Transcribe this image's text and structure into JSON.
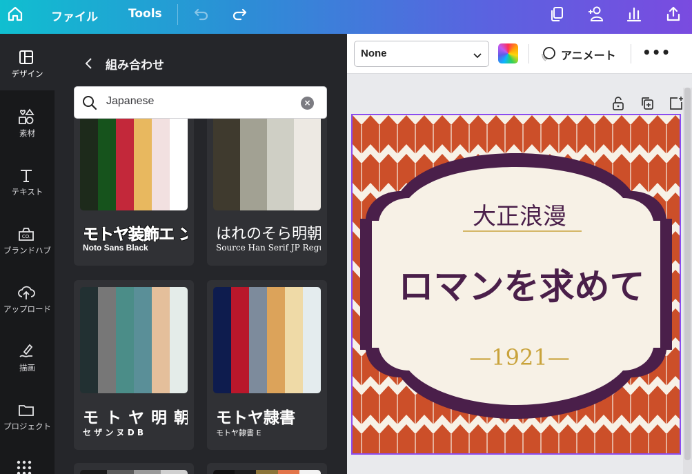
{
  "topbar": {
    "file_label": "ファイル",
    "tools_label": "Tools",
    "icons": [
      "home-icon",
      "undo-icon",
      "redo-icon",
      "copy-icon",
      "add-people-icon",
      "chart-icon",
      "share-icon"
    ]
  },
  "rail": {
    "items": [
      {
        "label": "デザイン",
        "icon": "layout-icon"
      },
      {
        "label": "素材",
        "icon": "shapes-icon"
      },
      {
        "label": "テキスト",
        "icon": "text-icon"
      },
      {
        "label": "ブランドハブ",
        "icon": "brand-icon"
      },
      {
        "label": "アップロード",
        "icon": "upload-icon"
      },
      {
        "label": "描画",
        "icon": "draw-icon"
      },
      {
        "label": "プロジェクト",
        "icon": "folder-icon"
      }
    ]
  },
  "panel": {
    "title": "組み合わせ",
    "search": {
      "value": "Japanese"
    },
    "cards": [
      {
        "title": "モトヤ装飾エ ン",
        "subtitle": "Noto Sans Black",
        "colors": [
          "#1d2a1b",
          "#16531c",
          "#c3283a",
          "#e8b85f",
          "#f2e0e0",
          "#ffffff"
        ]
      },
      {
        "title": "はれのそら明朝",
        "subtitle": "Source Han Serif JP Regular",
        "colors": [
          "#3f3a2e",
          "#a2a193",
          "#cfcfc5",
          "#ede9e3"
        ]
      },
      {
        "title": "モ ト ヤ 明 朝",
        "subtitle": "セ ザ ン ヌ D B",
        "colors": [
          "#223032",
          "#777777",
          "#4b8d88",
          "#5a8f98",
          "#e4bf9b",
          "#e4ece9"
        ]
      },
      {
        "title": "モトヤ隷書",
        "subtitle": "モトヤ隷書 E",
        "colors": [
          "#0e1c4e",
          "#b9172b",
          "#7d8b9c",
          "#dca35a",
          "#efdaa7",
          "#e4ecee"
        ]
      }
    ],
    "partial_colors_1": [
      "#1b1b1b",
      "#5b5b5b",
      "#9a9a9a",
      "#d0d0d0"
    ],
    "partial_colors_2": [
      "#111111",
      "#1e1e1e",
      "#8c7439",
      "#e2754a",
      "#f2f2f2"
    ]
  },
  "editor": {
    "font_select": "None",
    "animate_label": "アニメート",
    "more_label": "•••"
  },
  "design": {
    "heading": "大正浪漫",
    "main_text": "ロマンを求めて",
    "year_text": "—1921—",
    "colors": {
      "pattern": "#cc4f29",
      "cream": "#f7f1e6",
      "frame": "#4a1f4a",
      "gold": "#c9a33b"
    }
  }
}
